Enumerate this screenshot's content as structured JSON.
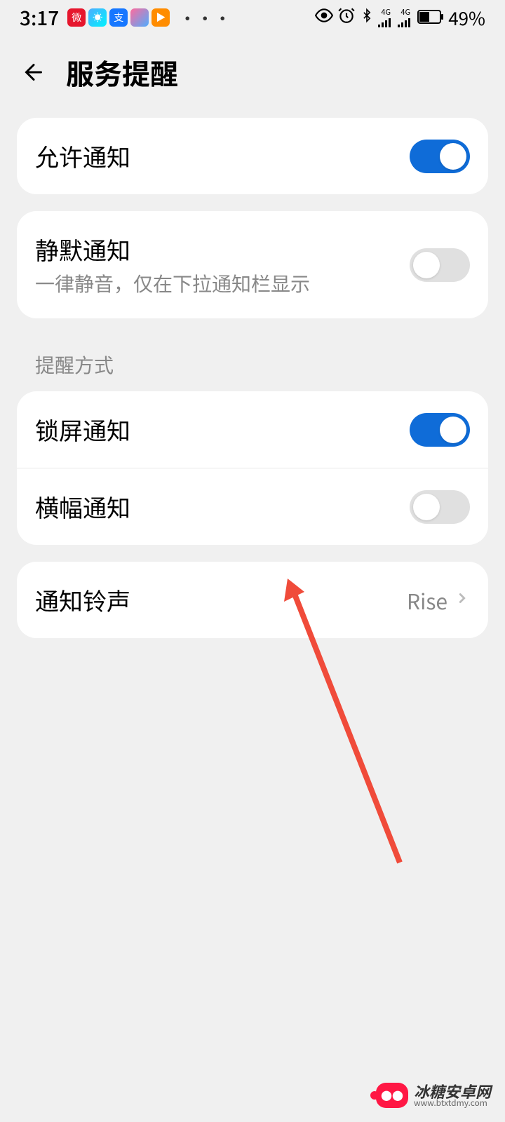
{
  "status_bar": {
    "time": "3:17",
    "dots": "···",
    "battery_percent": "49%"
  },
  "header": {
    "title": "服务提醒"
  },
  "section1": {
    "allow_notifications": {
      "label": "允许通知",
      "enabled": true
    },
    "silent_notifications": {
      "label": "静默通知",
      "sublabel": "一律静音，仅在下拉通知栏显示",
      "enabled": false
    }
  },
  "section_header": "提醒方式",
  "section2": {
    "lock_screen": {
      "label": "锁屏通知",
      "enabled": true
    },
    "banner": {
      "label": "横幅通知",
      "enabled": false
    }
  },
  "section3": {
    "ringtone": {
      "label": "通知铃声",
      "value": "Rise"
    }
  },
  "watermark": {
    "main": "冰糖安卓网",
    "sub": "www.btxtdmy.com"
  }
}
